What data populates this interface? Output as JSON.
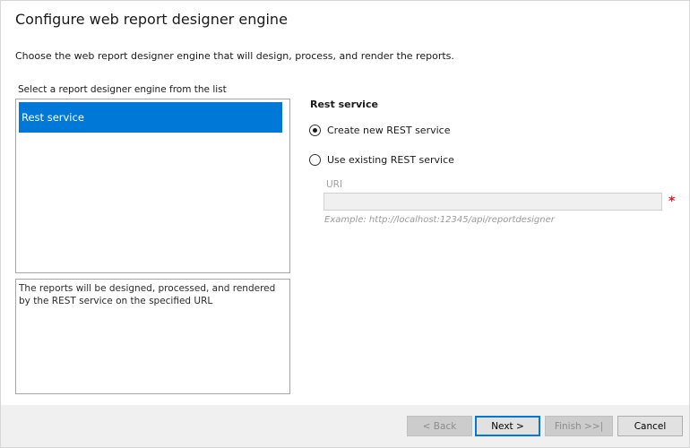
{
  "page": {
    "title": "Configure web report designer engine",
    "description": "Choose the web report designer engine that will design, process, and render the reports."
  },
  "engine_list": {
    "label": "Select a report designer engine from the list",
    "items": [
      {
        "label": "Rest service",
        "selected": true
      }
    ],
    "description": "The reports will be designed, processed, and rendered by the REST service on the specified URL"
  },
  "rest_service": {
    "section_title": "Rest service",
    "options": [
      {
        "label": "Create new REST service",
        "checked": true
      },
      {
        "label": "Use existing REST service",
        "checked": false
      }
    ],
    "uri": {
      "label": "URI",
      "value": "",
      "required_mark": "*",
      "example": "Example: http://localhost:12345/api/reportdesigner",
      "enabled": false
    }
  },
  "footer": {
    "back_label": "< Back",
    "next_label": "Next >",
    "finish_label": "Finish >>|",
    "cancel_label": "Cancel"
  },
  "colors": {
    "selection": "#0078d7",
    "required": "#e81123",
    "footer_bg": "#f0f0f0"
  }
}
